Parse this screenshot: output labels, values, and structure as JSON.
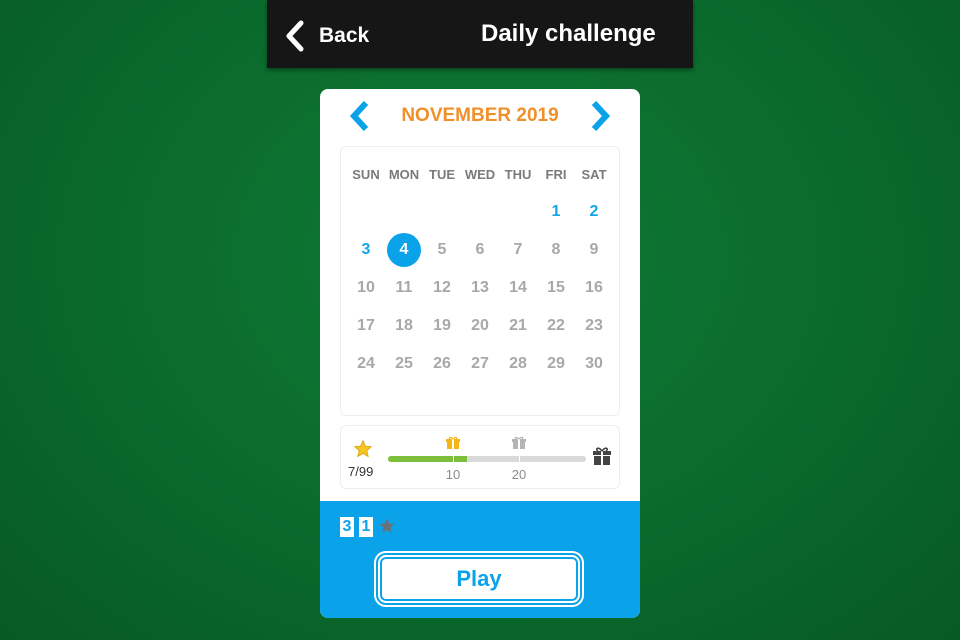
{
  "header": {
    "back_label": "Back",
    "title": "Daily challenge"
  },
  "calendar": {
    "month_label": "NOVEMBER 2019",
    "weekdays": [
      "SUN",
      "MON",
      "TUE",
      "WED",
      "THU",
      "FRI",
      "SAT"
    ],
    "first_weekday_index": 5,
    "days_in_month": 30,
    "completed_days": [
      1,
      2,
      3
    ],
    "selected_day": 4,
    "colors": {
      "accent": "#0aa3ea",
      "month_label": "#f0902a",
      "inactive_day": "#a8a8a8"
    }
  },
  "progress": {
    "stars_label": "7/99",
    "stars_earned": 7,
    "stars_total": 99,
    "fill_fraction": 0.4,
    "milestones": [
      {
        "label": "10",
        "status": "reached",
        "icon": "gift-icon"
      },
      {
        "label": "20",
        "status": "locked",
        "icon": "gift-icon"
      }
    ],
    "final_reward_icon": "gift-icon",
    "colors": {
      "fill": "#7cbe3a",
      "track": "#d9d9d9",
      "star": "#f7c520"
    }
  },
  "footer": {
    "score_digits": [
      "3",
      "1"
    ],
    "score_icon": "star-icon",
    "play_label": "Play"
  }
}
